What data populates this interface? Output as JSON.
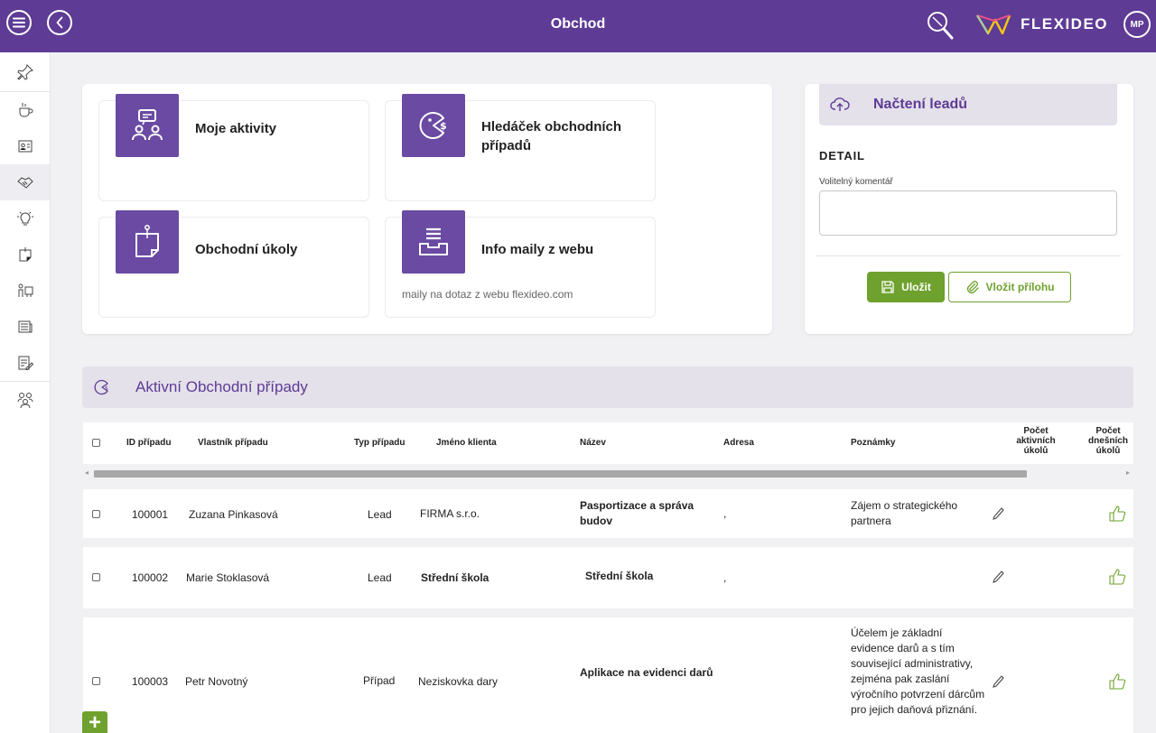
{
  "header": {
    "title": "Obchod",
    "logo_text": "FLEXIDEO",
    "user_initials": "MP"
  },
  "tiles": [
    {
      "title": "Moje aktivity",
      "subtitle": ""
    },
    {
      "title": "Hledáček obchodních případů",
      "subtitle": ""
    },
    {
      "title": "Obchodní úkoly",
      "subtitle": ""
    },
    {
      "title": "Info maily z webu",
      "subtitle": "maily na dotaz z webu flexideo.com"
    }
  ],
  "lead_panel": {
    "title": "Načtení leadů",
    "detail_label": "DETAIL",
    "comment_label": "Volitelný komentář",
    "comment_value": "",
    "save_label": "Uložit",
    "attach_label": "Vložit přílohu"
  },
  "cases": {
    "title": "Aktivní Obchodní případy",
    "columns": {
      "id": "ID případu",
      "owner": "Vlastník případu",
      "type": "Typ případu",
      "client": "Jméno klienta",
      "name": "Název",
      "address": "Adresa",
      "notes": "Poznámky",
      "active_tasks": "Počet aktivních úkolů",
      "today_tasks": "Počet dnešních úkolů"
    },
    "rows": [
      {
        "id": "100001",
        "owner": "Zuzana Pinkasová",
        "type": "Lead",
        "client": "FIRMA s.r.o.",
        "name": "Pasportizace a správa budov",
        "address": ",",
        "notes": "Zájem o strategického partnera"
      },
      {
        "id": "100002",
        "owner": "Marie Stoklasová",
        "type": "Lead",
        "client": "Střední škola",
        "name": "Střední škola",
        "address": ",",
        "notes": ""
      },
      {
        "id": "100003",
        "owner": "Petr Novotný",
        "type": "Případ",
        "client": "Neziskovka dary",
        "name": "Aplikace na evidenci darů",
        "address": "",
        "notes": "Účelem je základní evidence darů a s tím související administrativy, zejména pak zaslání výročního potvrzení dárcům pro jejich daňová přiznání."
      }
    ]
  },
  "colors": {
    "brand": "#5e3b95",
    "accent_green": "#6ea12d",
    "tile_icon": "#6a4aa3",
    "section_bg": "#e4e1ea"
  }
}
